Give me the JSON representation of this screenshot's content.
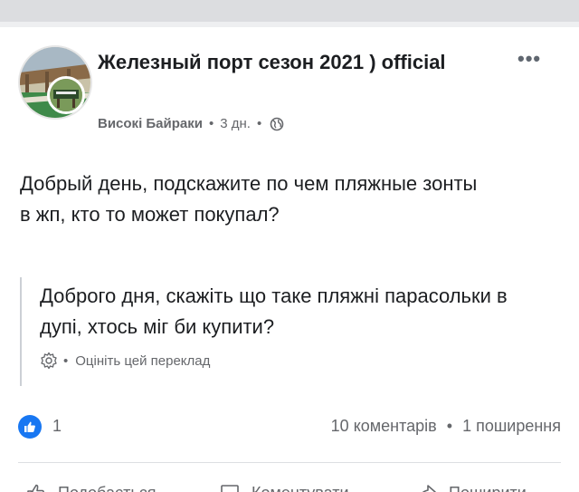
{
  "post": {
    "group_name": "Железный порт сезон 2021 ) official",
    "author": "Високі Байраки",
    "separator": "•",
    "time": "3 дн.",
    "more_label": "•••",
    "body": "Добрый день, подскажите по чем пляжные зонты в жп, кто то может покупал?",
    "translation": {
      "text": "Доброго дня, скажіть що таке пляжні парасольки в дупі, хтось міг би купити?",
      "rate_label": "Оцініть цей переклад"
    },
    "stats": {
      "likes": "1",
      "comments": "10 коментарів",
      "shares": "1 поширення"
    },
    "actions": [
      {
        "label": "Подобається"
      },
      {
        "label": "Коментувати"
      },
      {
        "label": "Поширити"
      }
    ]
  },
  "colors": {
    "text": "#1c1e21",
    "secondary": "#65676b",
    "like_blue": "#1877f2",
    "divider": "#dddfe2"
  },
  "icons": [
    "avatar-image",
    "globe-icon",
    "more-icon",
    "gear-icon",
    "like-icon",
    "thumb-up-icon",
    "comment-icon",
    "share-icon"
  ]
}
